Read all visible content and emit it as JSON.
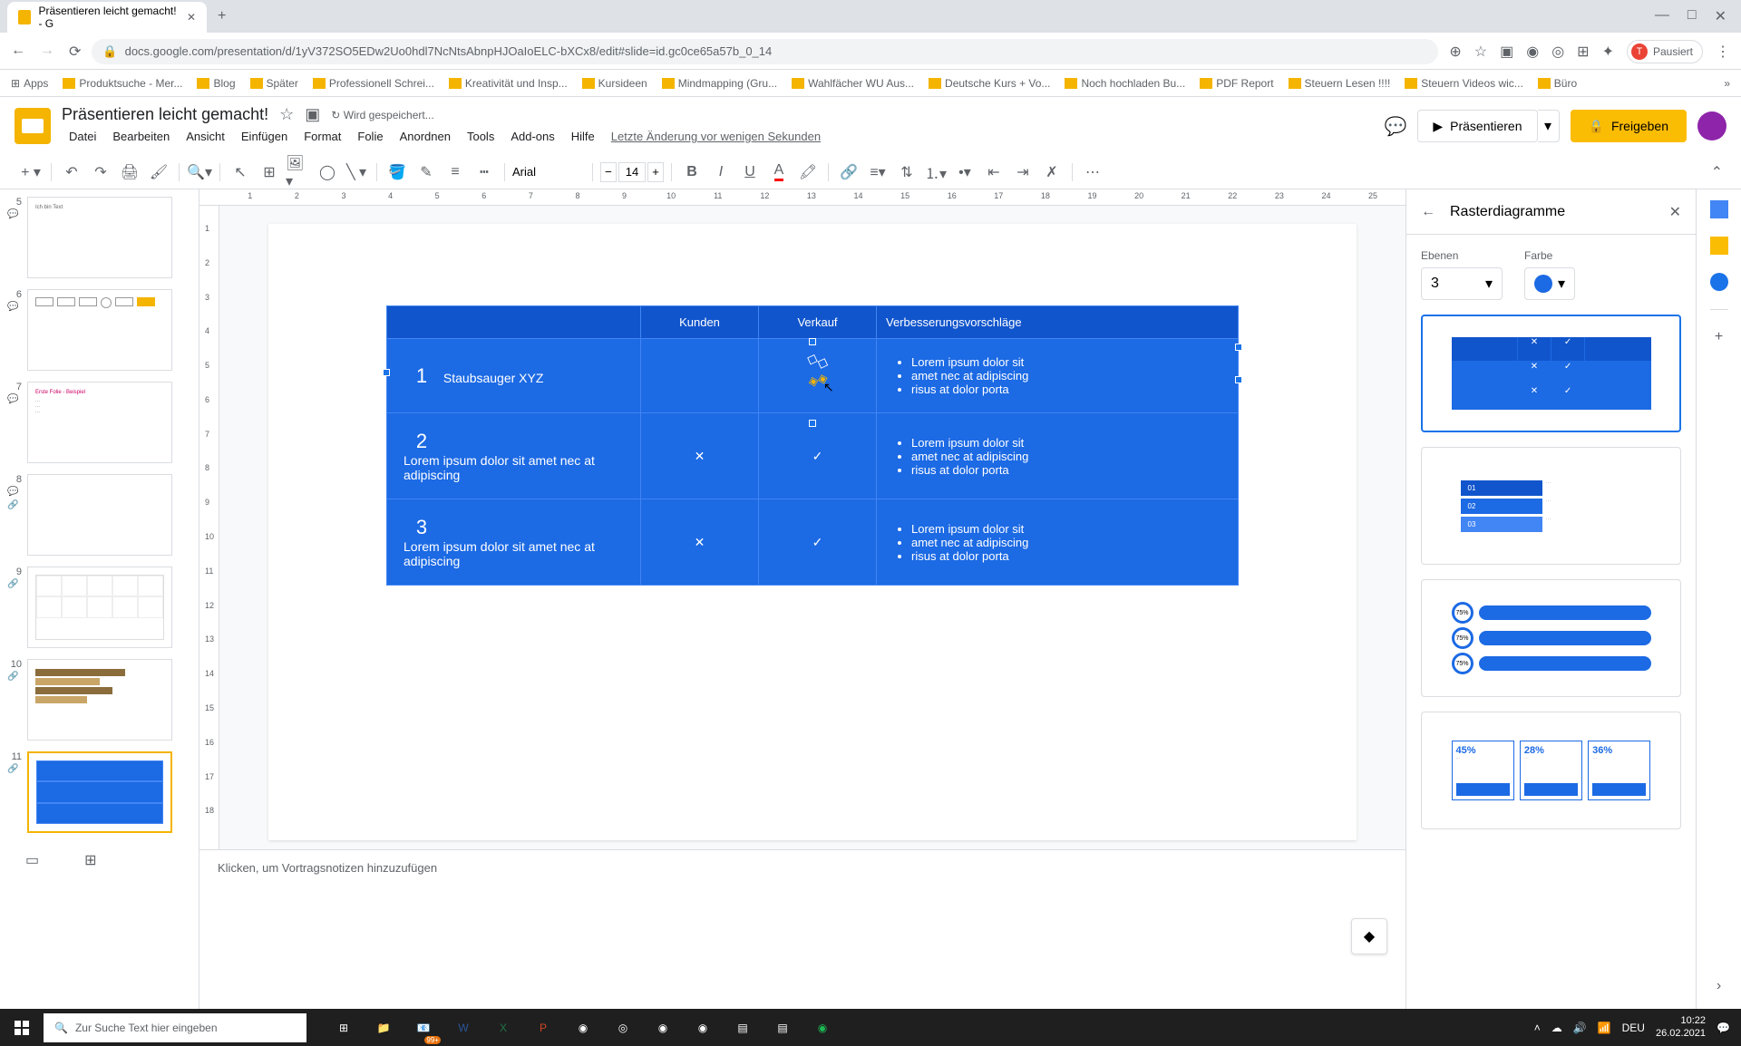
{
  "browser": {
    "tab_title": "Präsentieren leicht gemacht! - G",
    "url": "docs.google.com/presentation/d/1yV372SO5EDw2Uo0hdl7NcNtsAbnpHJOaIoELC-bXCx8/edit#slide=id.gc0ce65a57b_0_14",
    "profile_status": "Pausiert",
    "bookmarks": [
      "Apps",
      "Produktsuche - Mer...",
      "Blog",
      "Später",
      "Professionell Schrei...",
      "Kreativität und Insp...",
      "Kursideen",
      "Mindmapping (Gru...",
      "Wahlfächer WU Aus...",
      "Deutsche Kurs + Vo...",
      "Noch hochladen Bu...",
      "PDF Report",
      "Steuern Lesen !!!!",
      "Steuern Videos wic...",
      "Büro"
    ]
  },
  "app": {
    "title": "Präsentieren leicht gemacht!",
    "save_status": "Wird gespeichert...",
    "menus": [
      "Datei",
      "Bearbeiten",
      "Ansicht",
      "Einfügen",
      "Format",
      "Folie",
      "Anordnen",
      "Tools",
      "Add-ons",
      "Hilfe"
    ],
    "last_edit": "Letzte Änderung vor wenigen Sekunden",
    "present_btn": "Präsentieren",
    "share_btn": "Freigeben"
  },
  "toolbar": {
    "font": "Arial",
    "font_size": "14"
  },
  "slides": [
    {
      "num": "5"
    },
    {
      "num": "6"
    },
    {
      "num": "7"
    },
    {
      "num": "8"
    },
    {
      "num": "9"
    },
    {
      "num": "10"
    },
    {
      "num": "11",
      "active": true
    }
  ],
  "ruler_h": [
    "",
    "1",
    "2",
    "3",
    "4",
    "5",
    "6",
    "7",
    "8",
    "9",
    "10",
    "11",
    "12",
    "13",
    "14",
    "15",
    "16",
    "17",
    "18",
    "19",
    "20",
    "21",
    "22",
    "23",
    "24",
    "25"
  ],
  "ruler_v": [
    "1",
    "2",
    "3",
    "4",
    "5",
    "6",
    "7",
    "8",
    "9",
    "10",
    "11",
    "12",
    "13",
    "14",
    "15",
    "16",
    "17",
    "18"
  ],
  "table": {
    "headers": [
      "",
      "Kunden",
      "Verkauf",
      "Verbesserungsvorschläge"
    ],
    "rows": [
      {
        "num": "1",
        "label": "Staubsauger XYZ",
        "kunden": "",
        "verkauf": "",
        "suggestions": [
          "Lorem ipsum dolor sit",
          "amet nec at adipiscing",
          "risus at dolor porta"
        ]
      },
      {
        "num": "2",
        "label": "Lorem ipsum dolor sit amet nec at adipiscing",
        "kunden": "✕",
        "verkauf": "✓",
        "suggestions": [
          "Lorem ipsum dolor sit",
          "amet nec at adipiscing",
          "risus at dolor porta"
        ]
      },
      {
        "num": "3",
        "label": "Lorem ipsum dolor sit amet nec at adipiscing",
        "kunden": "✕",
        "verkauf": "✓",
        "suggestions": [
          "Lorem ipsum dolor sit",
          "amet nec at adipiscing",
          "risus at dolor porta"
        ]
      }
    ]
  },
  "speaker_notes_placeholder": "Klicken, um Vortragsnotizen hinzuzufügen",
  "right_panel": {
    "title": "Rasterdiagramme",
    "levels_label": "Ebenen",
    "levels_value": "3",
    "color_label": "Farbe"
  },
  "taskbar": {
    "search_placeholder": "Zur Suche Text hier eingeben",
    "badge": "99+",
    "time": "10:22",
    "date": "26.02.2021",
    "lang": "DEU"
  }
}
